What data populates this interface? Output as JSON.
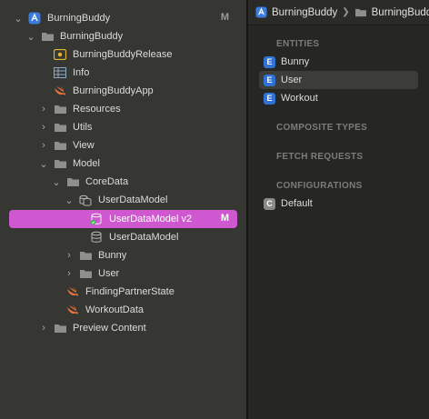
{
  "navigator": {
    "items": [
      {
        "label": "BurningBuddy",
        "icon": "xcode-project-icon",
        "badge": "M",
        "chevron": "down"
      },
      {
        "label": "BurningBuddy",
        "icon": "folder-icon",
        "chevron": "down"
      },
      {
        "label": "BurningBuddyRelease",
        "icon": "scheme-config-icon"
      },
      {
        "label": "Info",
        "icon": "plist-table-icon"
      },
      {
        "label": "BurningBuddyApp",
        "icon": "swift-file-icon"
      },
      {
        "label": "Resources",
        "icon": "folder-icon",
        "chevron": "right"
      },
      {
        "label": "Utils",
        "icon": "folder-icon",
        "chevron": "right"
      },
      {
        "label": "View",
        "icon": "folder-icon",
        "chevron": "right"
      },
      {
        "label": "Model",
        "icon": "folder-icon",
        "chevron": "down"
      },
      {
        "label": "CoreData",
        "icon": "folder-icon",
        "chevron": "down"
      },
      {
        "label": "UserDataModel",
        "icon": "data-model-bundle-icon",
        "chevron": "down"
      },
      {
        "label": "UserDataModel v2",
        "icon": "data-model-current-icon",
        "badge": "M",
        "selected": true
      },
      {
        "label": "UserDataModel",
        "icon": "data-model-icon"
      },
      {
        "label": "Bunny",
        "icon": "folder-icon",
        "chevron": "right"
      },
      {
        "label": "User",
        "icon": "folder-icon",
        "chevron": "right"
      },
      {
        "label": "FindingPartnerState",
        "icon": "swift-file-icon"
      },
      {
        "label": "WorkoutData",
        "icon": "swift-file-icon"
      },
      {
        "label": "Preview Content",
        "icon": "folder-icon",
        "chevron": "right"
      }
    ]
  },
  "editor": {
    "jump_bar": [
      "BurningBuddy",
      "BurningBuddy"
    ],
    "sections": {
      "entities": "ENTITIES",
      "composite_types": "COMPOSITE TYPES",
      "fetch_requests": "FETCH REQUESTS",
      "configurations": "CONFIGURATIONS"
    },
    "entities": [
      {
        "badge": "E",
        "label": "Bunny"
      },
      {
        "badge": "E",
        "label": "User",
        "selected": true
      },
      {
        "badge": "E",
        "label": "Workout"
      }
    ],
    "configurations": [
      {
        "badge": "C",
        "label": "Default"
      }
    ]
  },
  "colors": {
    "selection": "#cf57cf",
    "entity_badge": "#2f73d6",
    "swift": "#f0733a",
    "folder": "#8f8f8b"
  }
}
